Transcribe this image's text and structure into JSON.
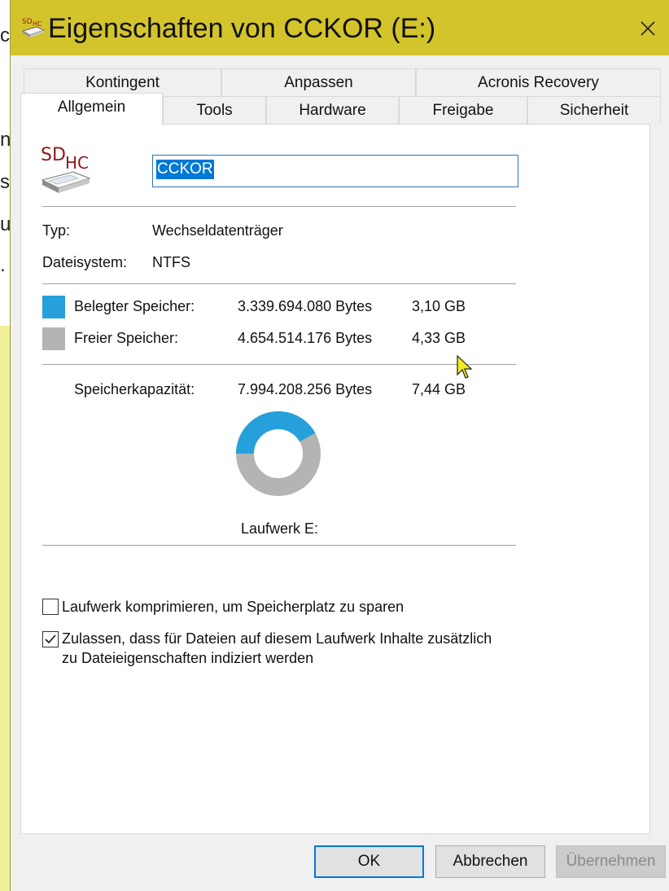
{
  "window": {
    "title": "Eigenschaften von CCKOR (E:)",
    "title_bar_color": "#d4c42c"
  },
  "background_fragments": [
    "c",
    "n",
    "se",
    "u",
    "."
  ],
  "tabs": {
    "row_back": [
      {
        "label": "Kontingent"
      },
      {
        "label": "Anpassen"
      },
      {
        "label": "Acronis Recovery"
      }
    ],
    "row_front": [
      {
        "label": "Allgemein",
        "active": true
      },
      {
        "label": "Tools"
      },
      {
        "label": "Hardware"
      },
      {
        "label": "Freigabe"
      },
      {
        "label": "Sicherheit"
      }
    ]
  },
  "drive": {
    "icon": "sdhc-card-icon",
    "icon_text": "SDHC",
    "name_value": "CCKOR"
  },
  "info": {
    "type_label": "Typ:",
    "type_value": "Wechseldatenträger",
    "fs_label": "Dateisystem:",
    "fs_value": "NTFS"
  },
  "storage": {
    "used_label": "Belegter Speicher:",
    "used_bytes": "3.339.694.080 Bytes",
    "used_gb": "3,10 GB",
    "used_color": "#26a0da",
    "free_label": "Freier Speicher:",
    "free_bytes": "4.654.514.176 Bytes",
    "free_gb": "4,33 GB",
    "free_color": "#b4b4b4",
    "capacity_label": "Speicherkapazität:",
    "capacity_bytes": "7.994.208.256 Bytes",
    "capacity_gb": "7,44 GB",
    "used_fraction": 0.418,
    "drive_label": "Laufwerk E:"
  },
  "options": {
    "compress_label": "Laufwerk komprimieren, um Speicherplatz zu sparen",
    "compress_checked": false,
    "index_label_line1": "Zulassen, dass für Dateien auf diesem Laufwerk Inhalte zusätzlich",
    "index_label_line2": "zu Dateieigenschaften indiziert werden",
    "index_checked": true
  },
  "buttons": {
    "ok": "OK",
    "cancel": "Abbrechen",
    "apply": "Übernehmen"
  }
}
